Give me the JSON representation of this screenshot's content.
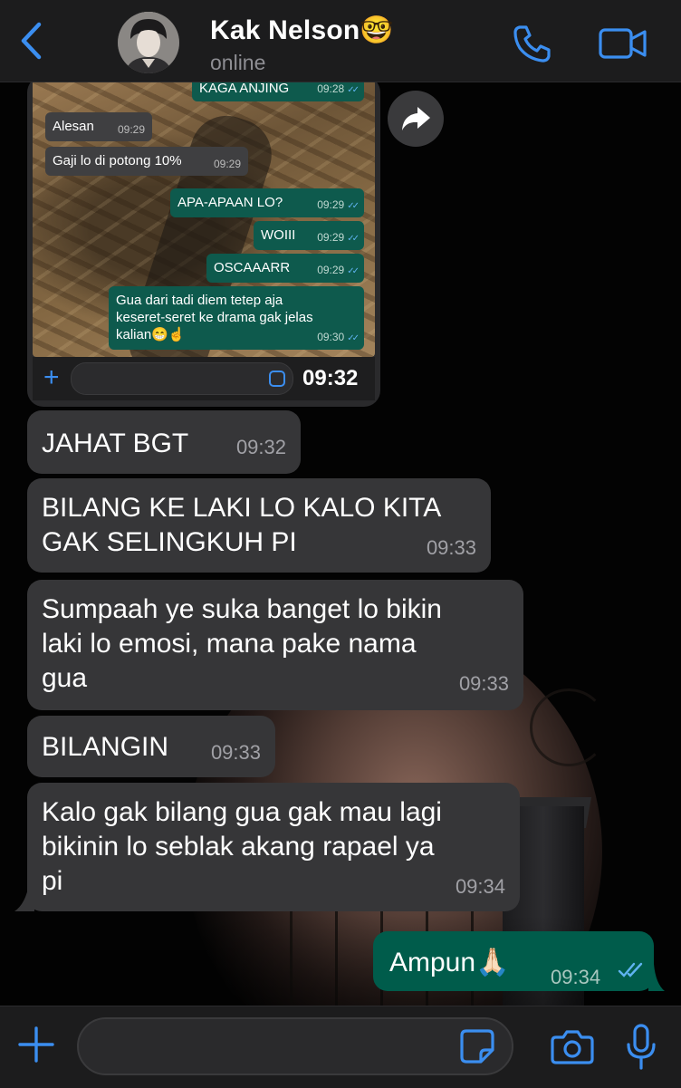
{
  "header": {
    "back_icon": "chevron-left-icon",
    "contact_name": "Kak Nelson🤓",
    "status": "online",
    "call_icon": "phone-icon",
    "video_icon": "video-camera-icon"
  },
  "screenshot_message": {
    "time": "09:32",
    "inner_messages": [
      {
        "text": "KAGA ANJING",
        "time": "09:28",
        "dir": "out"
      },
      {
        "text": "Alesan",
        "time": "09:29",
        "dir": "in"
      },
      {
        "text": "Gaji lo di potong 10%",
        "time": "09:29",
        "dir": "in"
      },
      {
        "text": "APA-APAAN LO?",
        "time": "09:29",
        "dir": "out"
      },
      {
        "text": "WOIII",
        "time": "09:29",
        "dir": "out"
      },
      {
        "text": "OSCAAARR",
        "time": "09:29",
        "dir": "out"
      },
      {
        "line1": "Gua dari tadi diem tetep aja",
        "line2": "keseret-seret ke drama gak jelas",
        "line3": "kalian😁☝️",
        "time": "09:30",
        "dir": "out"
      }
    ]
  },
  "messages": [
    {
      "lines": [
        "JAHAT BGT"
      ],
      "time": "09:32",
      "dir": "in"
    },
    {
      "lines": [
        "BILANG KE LAKI LO KALO KITA",
        "GAK SELINGKUH PI"
      ],
      "time": "09:33",
      "dir": "in"
    },
    {
      "lines": [
        "Sumpaah ye suka banget lo bikin",
        "laki lo emosi, mana pake nama",
        "gua"
      ],
      "time": "09:33",
      "dir": "in"
    },
    {
      "lines": [
        "BILANGIN"
      ],
      "time": "09:33",
      "dir": "in"
    },
    {
      "lines": [
        "Kalo gak bilang gua gak mau lagi",
        "bikinin lo seblak akang rapael ya",
        "pi"
      ],
      "time": "09:34",
      "dir": "in"
    },
    {
      "lines": [
        "Ampun🙏🏻"
      ],
      "time": "09:34",
      "dir": "out",
      "status": "read"
    }
  ],
  "input_bar": {
    "placeholder": "",
    "plus_icon": "plus-icon",
    "sticker_icon": "sticker-icon",
    "camera_icon": "camera-icon",
    "mic_icon": "microphone-icon"
  },
  "colors": {
    "accent": "#3b8ef0",
    "incoming_bubble": "#363638",
    "outgoing_bubble": "#005c4b",
    "read_ticks": "#5fb3f0"
  }
}
